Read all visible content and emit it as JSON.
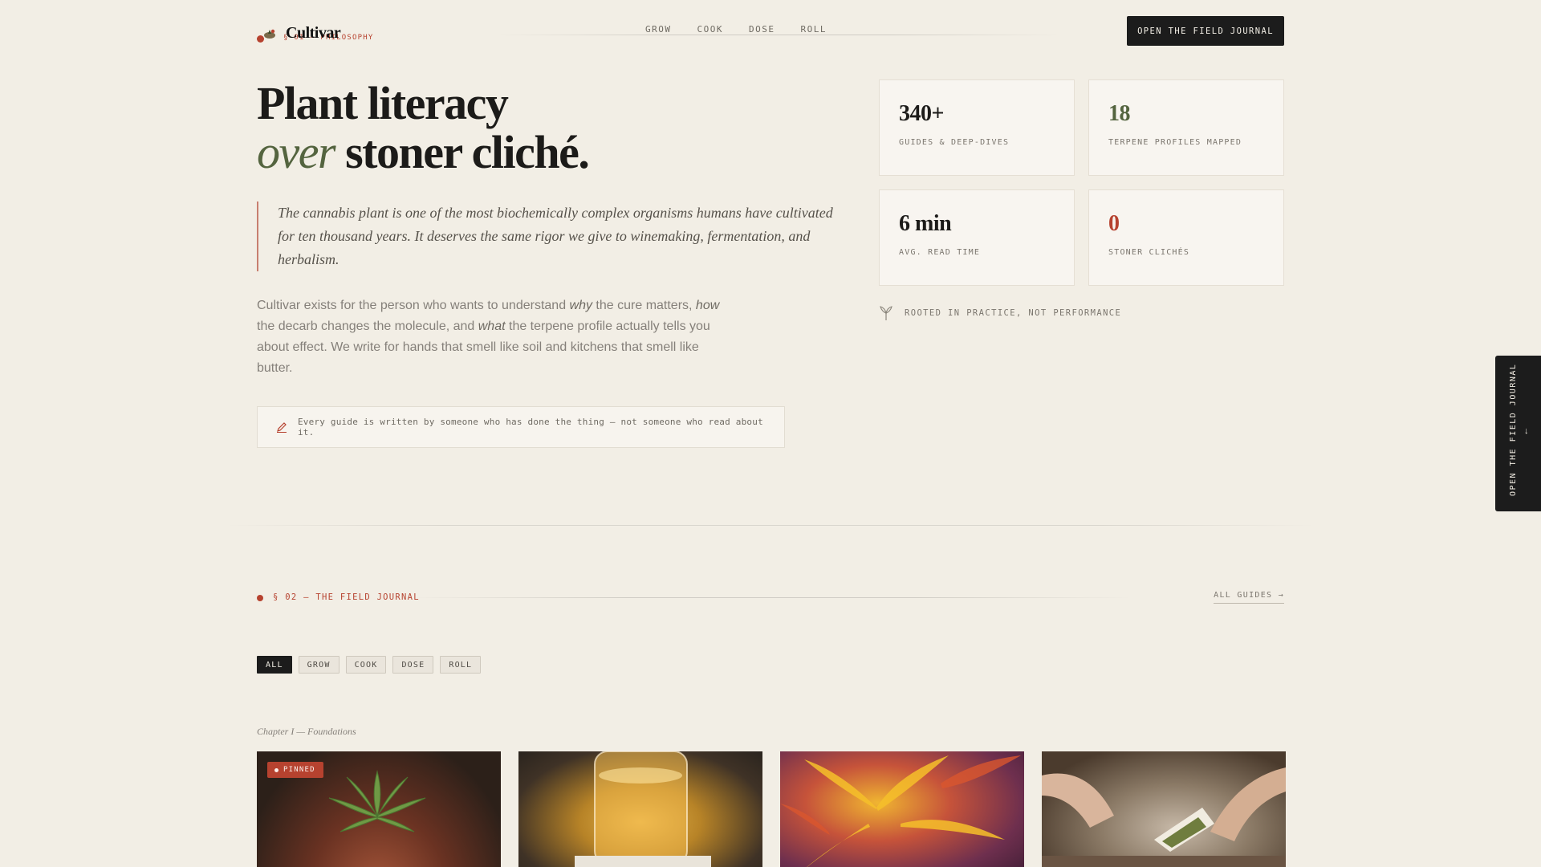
{
  "brand": {
    "name": "Cultivar",
    "overline": "§ 01 — PHILOSOPHY"
  },
  "nav": {
    "items": [
      "GROW",
      "COOK",
      "DOSE",
      "ROLL"
    ],
    "cta": "OPEN THE FIELD JOURNAL"
  },
  "hero": {
    "title_line1": "Plant literacy",
    "title_em": "over",
    "title_line2_rest": " stoner cliché.",
    "quote": "The cannabis plant is one of the most biochemically complex organisms humans have cultivated for ten thousand years. It deserves the same rigor we give to winemaking, fermentation, and herbalism.",
    "body_p1": "Cultivar exists for the person who wants to understand ",
    "body_em1": "why",
    "body_p2": " the cure matters, ",
    "body_em2": "how",
    "body_p3": " the decarb changes the molecule, and ",
    "body_em3": "what",
    "body_p4": " the terpene profile actually tells you about effect. We write for hands that smell like soil and kitchens that smell like butter.",
    "note": "Every guide is written by someone who has done the thing — not someone who read about it."
  },
  "stats": [
    {
      "value": "340+",
      "label": "GUIDES & DEEP-DIVES",
      "color": "#1c1b19"
    },
    {
      "value": "18",
      "label": "TERPENE PROFILES MAPPED",
      "color": "#54643f"
    },
    {
      "value": "6 min",
      "label": "AVG. READ TIME",
      "color": "#1c1b19"
    },
    {
      "value": "0",
      "label": "STONER CLICHÉS",
      "color": "#b6422f"
    }
  ],
  "rooted": "ROOTED IN PRACTICE, NOT PERFORMANCE",
  "side_tab": {
    "label": "OPEN THE FIELD JOURNAL",
    "arrow": "↓"
  },
  "journal": {
    "section_label": "§ 02 — THE FIELD JOURNAL",
    "all_guides": "ALL GUIDES →",
    "filters": [
      "ALL",
      "GROW",
      "COOK",
      "DOSE",
      "ROLL"
    ],
    "active_filter": "ALL",
    "chapter": "Chapter I — Foundations",
    "pinned_label": "PINNED"
  },
  "colors": {
    "background": "#f2eee5",
    "accent_red": "#b6422f",
    "accent_green": "#54643f",
    "dark": "#1c1c1c"
  }
}
